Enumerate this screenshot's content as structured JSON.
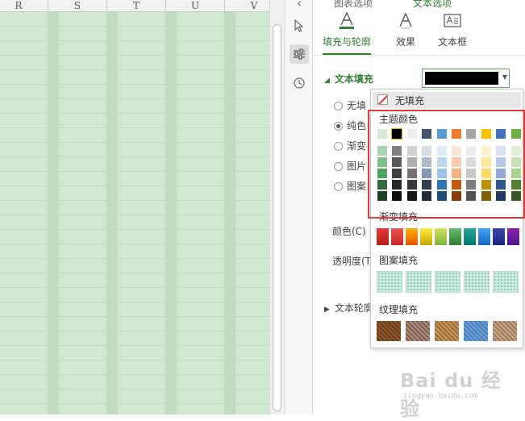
{
  "sheet": {
    "columns": [
      "R",
      "S",
      "T",
      "U",
      "V"
    ]
  },
  "panel": {
    "top_tabs": [
      "图表选项",
      "文本选项"
    ],
    "subtabs": [
      {
        "label": "填充与轮廓",
        "icon": "text-fill-icon"
      },
      {
        "label": "效果",
        "icon": "text-effect-icon"
      },
      {
        "label": "文本框",
        "icon": "textbox-icon"
      }
    ],
    "section_fill": "文本填充",
    "current_fill_color": "#000000",
    "radio_options": [
      "无填",
      "纯色",
      "渐变",
      "图片",
      "图案"
    ],
    "checked_option_index": 1,
    "color_label": "颜色(C)",
    "transparency_label": "透明度(T",
    "section_outline": "文本轮廓"
  },
  "dropdown": {
    "no_fill": "无填充",
    "theme_heading": "主题颜色",
    "gradient_heading": "渐变填充",
    "pattern_heading": "图案填充",
    "texture_heading": "纹理填充",
    "theme_row1": [
      "#d5ead8",
      "#000000",
      "#eeeeee",
      "#44546a",
      "#5b9bd5",
      "#ed7d31",
      "#a5a5a5",
      "#ffc000",
      "#4472c4",
      "#70ad47"
    ],
    "theme_shades": [
      [
        "#a9d4b0",
        "#7f7f7f",
        "#d0d0d0",
        "#d6dce5",
        "#deebf7",
        "#fbe5d6",
        "#ededed",
        "#fff2cc",
        "#dae3f3",
        "#e2f0d9"
      ],
      [
        "#7fc089",
        "#595959",
        "#aeaeae",
        "#adb9ca",
        "#bdd7ee",
        "#f8cbad",
        "#dbdbdb",
        "#ffe699",
        "#b4c7e7",
        "#c5e0b4"
      ],
      [
        "#4fa35c",
        "#3f3f3f",
        "#757171",
        "#8497b0",
        "#9dc3e6",
        "#f4b183",
        "#c9c9c9",
        "#ffd966",
        "#8faadc",
        "#a9d18e"
      ],
      [
        "#336b3c",
        "#262626",
        "#3a3838",
        "#333f50",
        "#2e75b6",
        "#c55a11",
        "#7b7b7b",
        "#bf9000",
        "#2f5597",
        "#548235"
      ],
      [
        "#1e4224",
        "#0d0d0d",
        "#171616",
        "#222a35",
        "#1f4e79",
        "#843c0c",
        "#525252",
        "#7f6000",
        "#203864",
        "#375623"
      ]
    ],
    "gradient_colors": [
      [
        "#e53935",
        "#b71c1c"
      ],
      [
        "#ef5350",
        "#c62828"
      ],
      [
        "#ffb300",
        "#e65100"
      ],
      [
        "#ffeb3b",
        "#c6a700"
      ],
      [
        "#d4e157",
        "#7cb342"
      ],
      [
        "#66bb6a",
        "#2e7d32"
      ],
      [
        "#26a69a",
        "#00796b"
      ],
      [
        "#42a5f5",
        "#1565c0"
      ],
      [
        "#3949ab",
        "#1a237e"
      ],
      [
        "#8e24aa",
        "#4a148c"
      ]
    ],
    "texture_colors": [
      [
        "#8b5a2b",
        "#6b3e1a"
      ],
      [
        "#b09080",
        "#7a5a4a"
      ],
      [
        "#c99a63",
        "#9c6b34"
      ],
      [
        "#6a9fd8",
        "#4a7fbf"
      ],
      [
        "#c8a889",
        "#9b7b5c"
      ]
    ]
  },
  "watermark": {
    "logo": "Bai du 经验",
    "url": "jingyan.baidu.com"
  }
}
